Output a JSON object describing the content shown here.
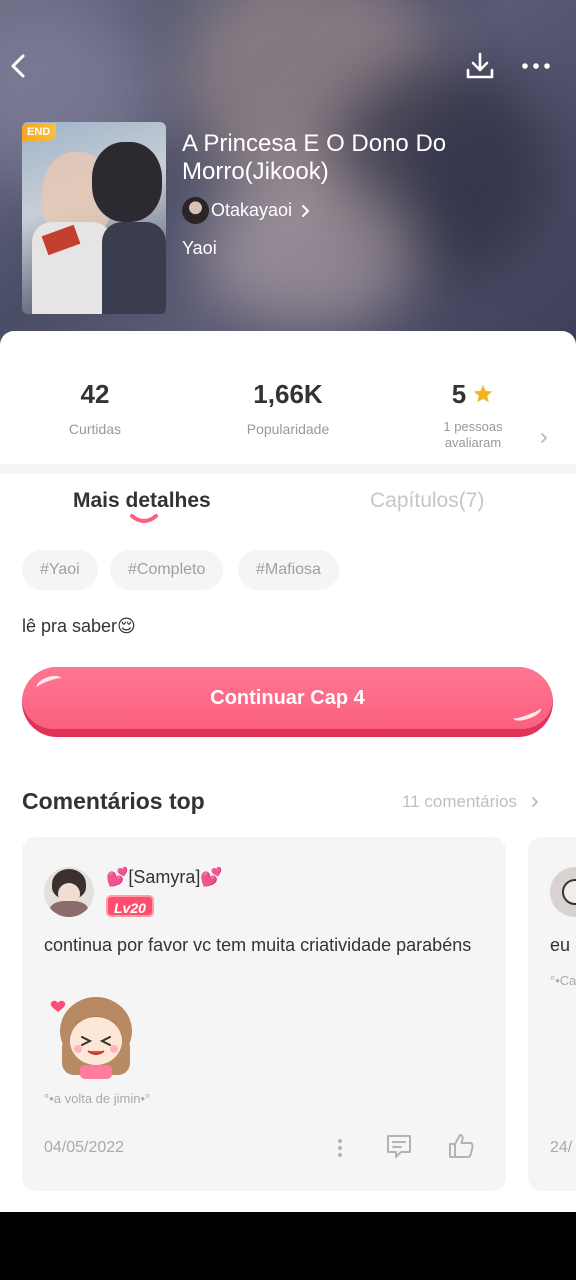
{
  "book": {
    "badge": "END",
    "title": "A Princesa E O Dono Do Morro(Jikook)",
    "author": "Otakayaoi",
    "genre": "Yaoi"
  },
  "stats": {
    "likes": {
      "value": "42",
      "label": "Curtidas"
    },
    "popularity": {
      "value": "1,66K",
      "label": "Popularidade"
    },
    "rating": {
      "value": "5",
      "label_line1": "1 pessoas",
      "label_line2": "avaliaram"
    }
  },
  "tabs": [
    {
      "label": "Mais detalhes",
      "active": true
    },
    {
      "label": "Capítulos(7)",
      "active": false
    }
  ],
  "tags": [
    "#Yaoi",
    "#Completo",
    "#Mafiosa"
  ],
  "description": "lê pra saber😌",
  "cta": {
    "label": "Continuar Cap 4"
  },
  "comments_section": {
    "title": "Comentários top",
    "count_label": "11 comentários"
  },
  "comments": [
    {
      "user": "💕[Samyra]💕",
      "level": "Lv20",
      "text": "continua por favor vc tem muita criatividade parabéns",
      "signature": "°•a volta de jimin•°",
      "date": "04/05/2022"
    },
    {
      "text": "eu",
      "signature": "°•Ca",
      "date": "24/"
    }
  ],
  "colors": {
    "accent": "#fb5f7e",
    "star": "#f5b41f",
    "badge": "#f5a623",
    "level_badge": "#ff4d6d"
  },
  "icons": {
    "back": "chevron-left-icon",
    "download": "download-icon",
    "more": "more-horizontal-icon",
    "star": "star-icon",
    "reply": "comment-icon",
    "like": "thumbs-up-icon"
  }
}
